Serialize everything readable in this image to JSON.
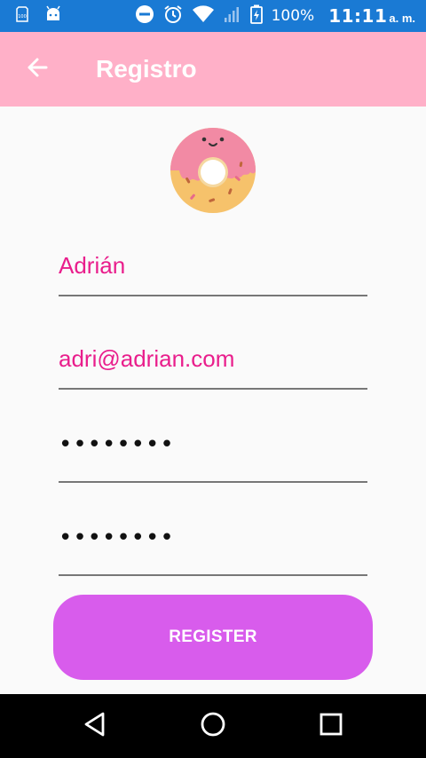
{
  "status_bar": {
    "battery_percent": "100%",
    "time": "11:11",
    "ampm": "a. m."
  },
  "app_bar": {
    "title": "Registro"
  },
  "form": {
    "name_value": "Adrián",
    "email_value": "adri@adrian.com",
    "password_value": "••••••••",
    "confirm_password_value": "••••••••"
  },
  "register_button": {
    "label": "REGISTER"
  },
  "colors": {
    "status_bar": "#1a7ad4",
    "app_bar": "#ffb0c8",
    "accent_text": "#e91e8c",
    "button": "#d85cec"
  },
  "icons": {
    "back": "arrow-left-icon",
    "logo": "donut-icon",
    "nav_back": "triangle-back-icon",
    "nav_home": "circle-home-icon",
    "nav_recents": "square-recents-icon"
  }
}
